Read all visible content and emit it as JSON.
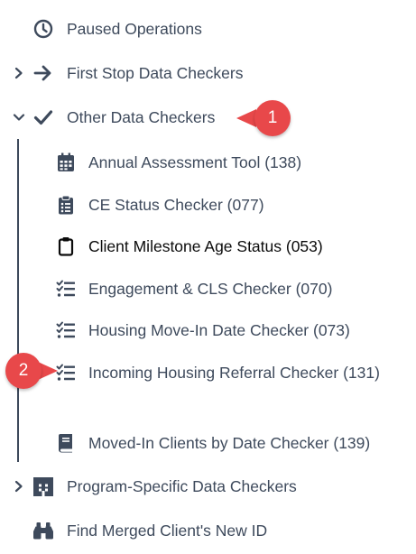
{
  "nav": {
    "paused": {
      "label": "Paused Operations",
      "icon": "clock-icon"
    },
    "first_stop": {
      "label": "First Stop Data Checkers",
      "icon": "arrow-right-icon",
      "expanded": false
    },
    "other": {
      "label": "Other Data Checkers",
      "icon": "checkmark-icon",
      "expanded": true
    },
    "children": [
      {
        "label": "Annual Assessment Tool (138)",
        "icon": "calendar-icon"
      },
      {
        "label": "CE Status Checker (077)",
        "icon": "clipboard-list-icon"
      },
      {
        "label": "Client Milestone Age Status (053)",
        "icon": "clipboard-icon",
        "active": true
      },
      {
        "label": "Engagement & CLS Checker (070)",
        "icon": "tasks-icon"
      },
      {
        "label": "Housing Move-In Date Checker (073)",
        "icon": "tasks-icon"
      },
      {
        "label": "Incoming Housing Referral Checker (131)",
        "icon": "tasks-icon"
      },
      {
        "label": "Moved-In Clients by Date Checker (139)",
        "icon": "book-icon"
      }
    ],
    "program_specific": {
      "label": "Program-Specific Data Checkers",
      "icon": "building-icon",
      "expanded": false
    },
    "find_merged": {
      "label": "Find Merged Client's New ID",
      "icon": "binoculars-icon"
    }
  },
  "callouts": [
    {
      "number": "1"
    },
    {
      "number": "2"
    }
  ],
  "colors": {
    "text": "#3e4a5c",
    "active_text": "#0b0b0b",
    "callout": "#e8484a"
  }
}
